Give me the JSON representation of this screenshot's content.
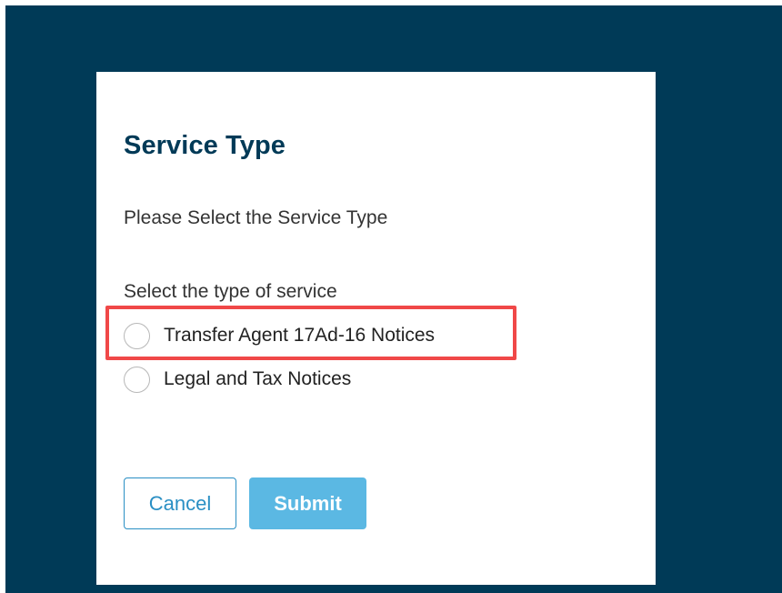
{
  "dialog": {
    "title": "Service Type",
    "subtitle": "Please Select the Service Type",
    "group_label": "Select the type of service",
    "options": [
      {
        "label": "Transfer Agent 17Ad-16 Notices",
        "selected": false
      },
      {
        "label": "Legal and Tax Notices",
        "selected": false
      }
    ],
    "cancel_label": "Cancel",
    "submit_label": "Submit"
  },
  "colors": {
    "backdrop": "#003a57",
    "title": "#003a57",
    "accent": "#2a8fc4",
    "submit_bg": "#5bb8e3",
    "highlight": "#f04848"
  }
}
